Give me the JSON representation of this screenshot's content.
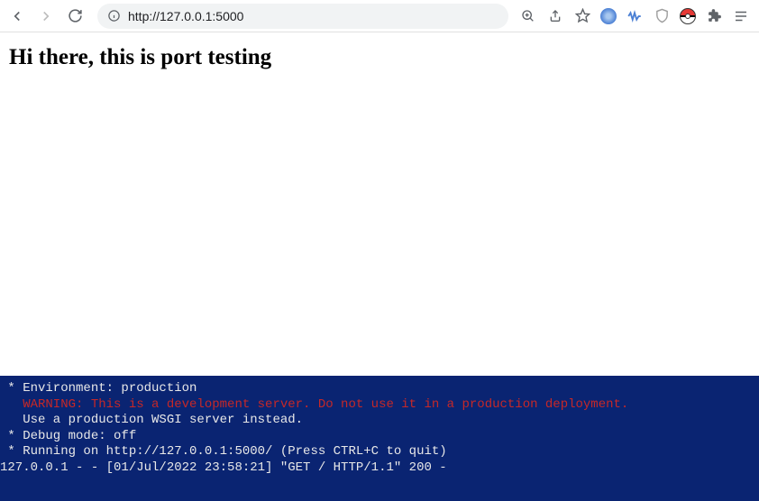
{
  "toolbar": {
    "url": "http://127.0.0.1:5000"
  },
  "page": {
    "heading": "Hi there, this is port testing"
  },
  "terminal": {
    "lines": [
      {
        "prefix": " * ",
        "text": "Environment: production",
        "cls": ""
      },
      {
        "prefix": "   ",
        "text": "WARNING: This is a development server. Do not use it in a production deployment.",
        "cls": "warn"
      },
      {
        "prefix": "   ",
        "text": "Use a production WSGI server instead.",
        "cls": ""
      },
      {
        "prefix": " * ",
        "text": "Debug mode: off",
        "cls": ""
      },
      {
        "prefix": " * ",
        "text": "Running on http://127.0.0.1:5000/ (Press CTRL+C to quit)",
        "cls": ""
      },
      {
        "prefix": "",
        "text": "127.0.0.1 - - [01/Jul/2022 23:58:21] \"GET / HTTP/1.1\" 200 -",
        "cls": ""
      }
    ]
  }
}
